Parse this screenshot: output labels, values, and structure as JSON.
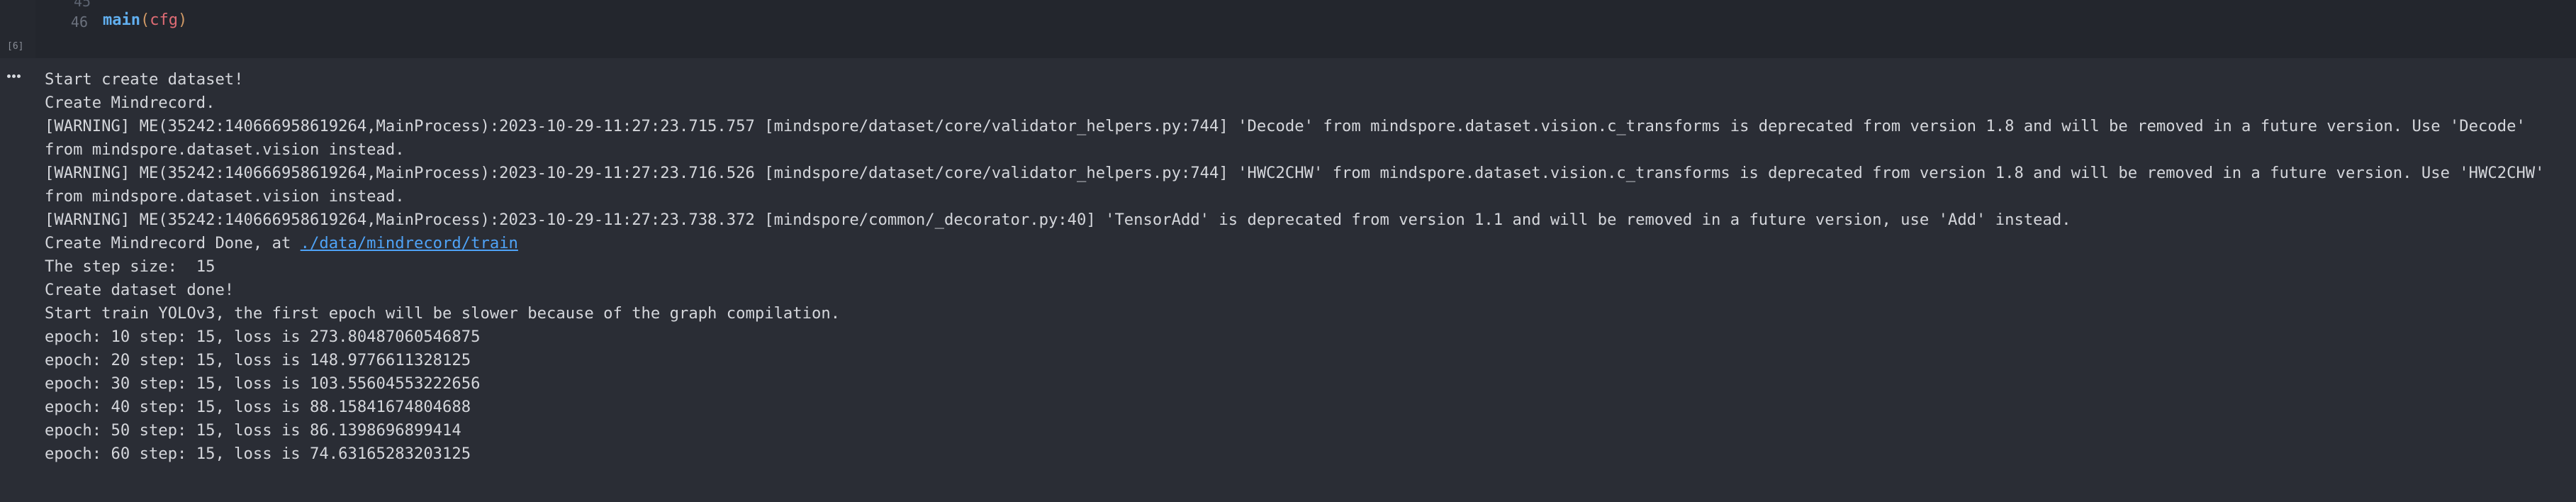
{
  "cell": {
    "execution_count": "[6]",
    "prev_line_number": "45",
    "line_number": "46",
    "code": {
      "fn": "main",
      "open_paren": "(",
      "arg": "cfg",
      "close_paren": ")"
    }
  },
  "output": {
    "more_icon": "ellipsis-icon",
    "lines": [
      "Start create dataset!",
      "Create Mindrecord.",
      "[WARNING] ME(35242:140666958619264,MainProcess):2023-10-29-11:27:23.715.757 [mindspore/dataset/core/validator_helpers.py:744] 'Decode' from mindspore.dataset.vision.c_transforms is deprecated from version 1.8 and will be removed in a future version. Use 'Decode' from mindspore.dataset.vision instead.",
      "[WARNING] ME(35242:140666958619264,MainProcess):2023-10-29-11:27:23.716.526 [mindspore/dataset/core/validator_helpers.py:744] 'HWC2CHW' from mindspore.dataset.vision.c_transforms is deprecated from version 1.8 and will be removed in a future version. Use 'HWC2CHW' from mindspore.dataset.vision instead.",
      "[WARNING] ME(35242:140666958619264,MainProcess):2023-10-29-11:27:23.738.372 [mindspore/common/_decorator.py:40] 'TensorAdd' is deprecated from version 1.1 and will be removed in a future version, use 'Add' instead."
    ],
    "mindrecord_done_prefix": "Create Mindrecord Done, at ",
    "mindrecord_done_link": "./data/mindrecord/train",
    "lines_after": [
      "The step size:  15",
      "Create dataset done!",
      "Start train YOLOv3, the first epoch will be slower because of the graph compilation.",
      "epoch: 10 step: 15, loss is 273.80487060546875",
      "epoch: 20 step: 15, loss is 148.9776611328125",
      "epoch: 30 step: 15, loss is 103.55604553222656",
      "epoch: 40 step: 15, loss is 88.15841674804688",
      "epoch: 50 step: 15, loss is 86.1398696899414",
      "epoch: 60 step: 15, loss is 74.63165283203125"
    ]
  }
}
